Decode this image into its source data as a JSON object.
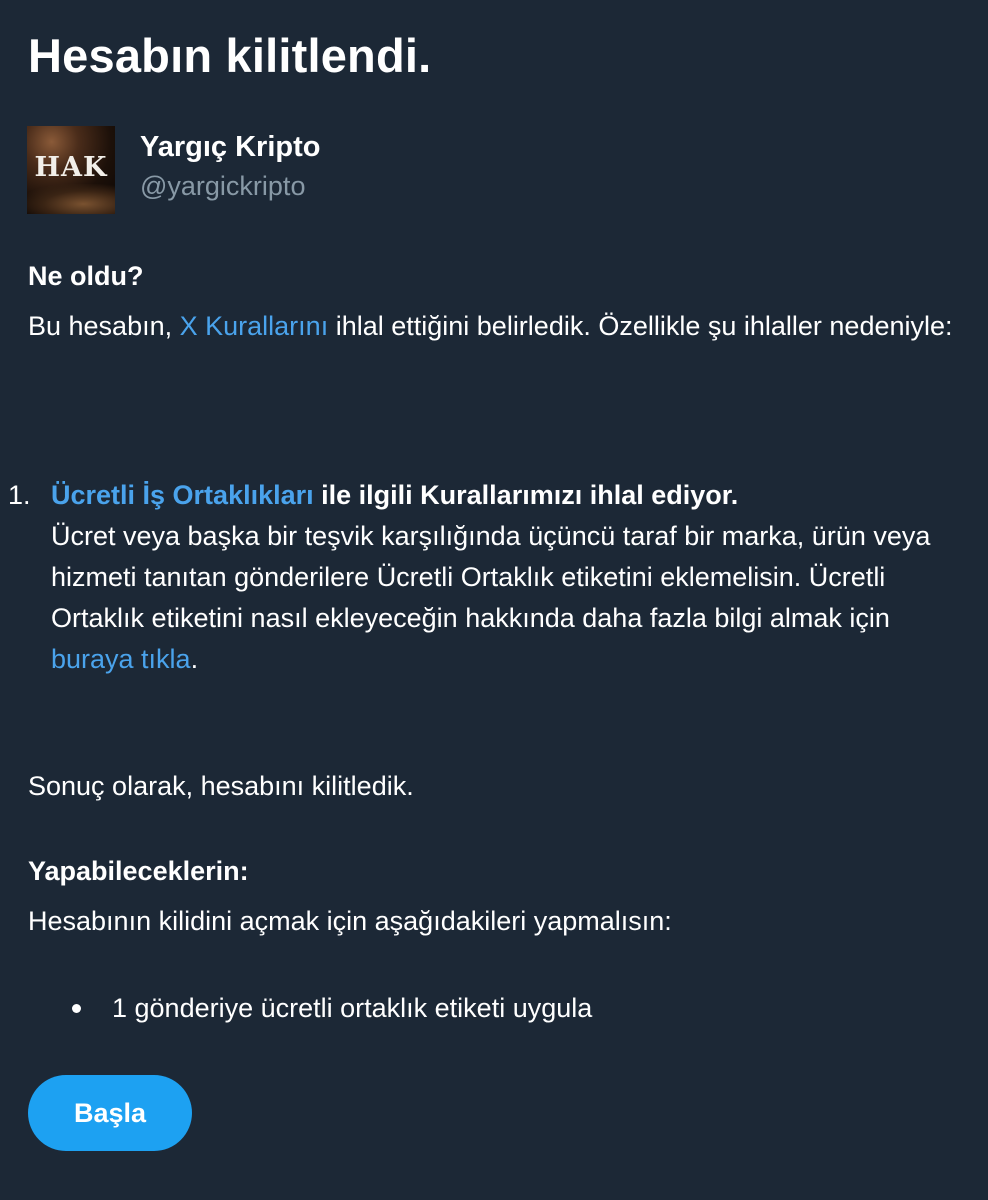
{
  "page_title": "Hesabın kilitlendi.",
  "profile": {
    "avatar_text": "HAK",
    "display_name": "Yargıç Kripto",
    "handle": "@yargickripto"
  },
  "what_happened": {
    "heading": "Ne oldu?",
    "text_before_link": "Bu hesabın, ",
    "rules_link": "X Kurallarını",
    "text_after_link": " ihlal ettiğini belirledik. Özellikle şu ihlaller nedeniyle:"
  },
  "violations": [
    {
      "number": "1.",
      "policy_link": "Ücretli İş Ortaklıkları",
      "headline_rest": " ile ilgili Kurallarımızı ihlal ediyor.",
      "description": "Ücret veya başka bir teşvik karşılığında üçüncü taraf bir marka, ürün veya hizmeti tanıtan gönderilere Ücretli Ortaklık etiketini eklemelisin. Ücretli Ortaklık etiketini nasıl ekleyeceğin hakkında daha fazla bilgi almak için ",
      "more_info_link": "buraya tıkla",
      "description_end": "."
    }
  ],
  "result_text": "Sonuç olarak, hesabını kilitledik.",
  "what_you_can_do": {
    "heading": "Yapabileceklerin:",
    "intro": "Hesabının kilidini açmak için aşağıdakileri yapmalısın:",
    "items": [
      "1 gönderiye ücretli ortaklık etiketi uygula"
    ]
  },
  "start_button_label": "Başla",
  "colors": {
    "background": "#1c2836",
    "link": "#4aa3ec",
    "button": "#1da1f2",
    "secondary_text": "#8899a6"
  }
}
